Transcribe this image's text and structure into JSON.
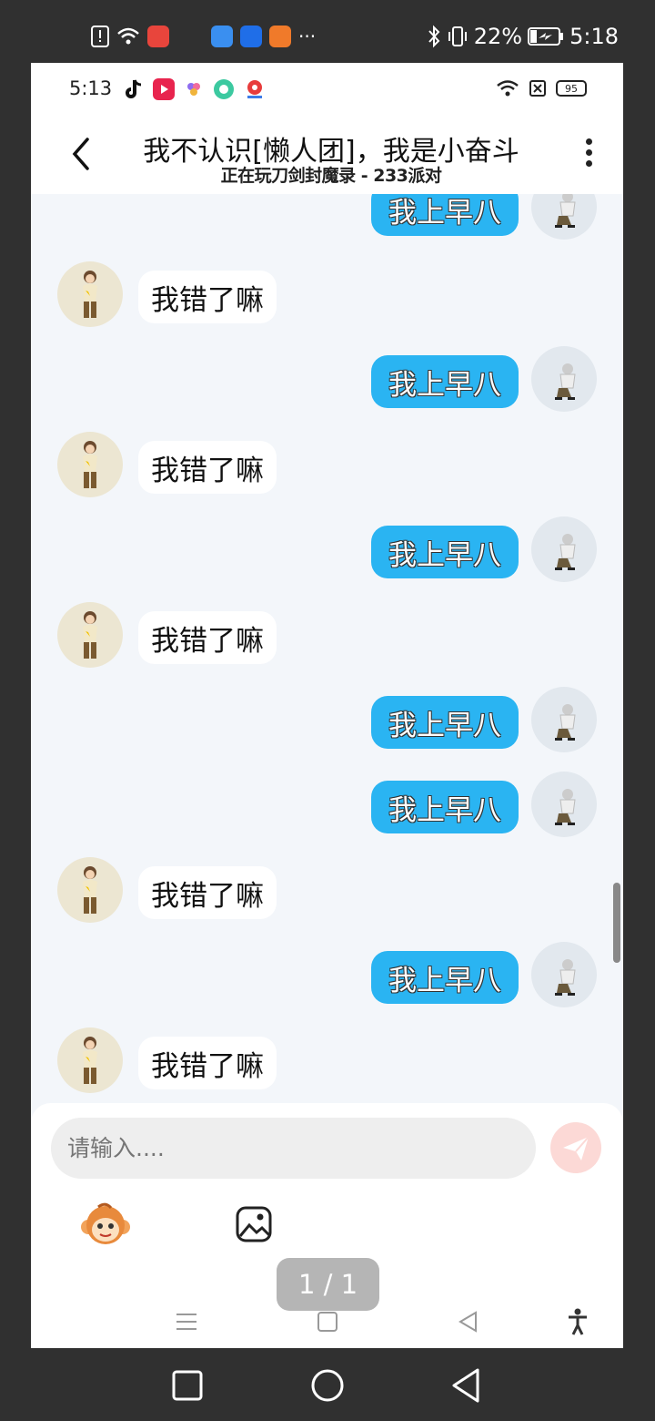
{
  "outer_status": {
    "time": "5:18",
    "battery": "22%"
  },
  "inner_status": {
    "time": "5:13",
    "battery": "95"
  },
  "header": {
    "title": "我不认识[懒人团]，我是小奋斗",
    "subtitle": "正在玩刀剑封魔录 - 233派对"
  },
  "messages": [
    {
      "from": "me",
      "text": "我上早八"
    },
    {
      "from": "her",
      "text": "我错了嘛"
    },
    {
      "from": "me",
      "text": "我上早八"
    },
    {
      "from": "her",
      "text": "我错了嘛"
    },
    {
      "from": "me",
      "text": "我上早八"
    },
    {
      "from": "her",
      "text": "我错了嘛"
    },
    {
      "from": "me",
      "text": "我上早八"
    },
    {
      "from": "me",
      "text": "我上早八"
    },
    {
      "from": "her",
      "text": "我错了嘛"
    },
    {
      "from": "me",
      "text": "我上早八"
    },
    {
      "from": "her",
      "text": "我错了嘛"
    }
  ],
  "composer": {
    "placeholder": "请输入...."
  },
  "pager": "1 / 1",
  "colors": {
    "my_bubble": "#2ab4f2",
    "send_button": "#fcd9d6"
  },
  "icons": [
    "back-icon",
    "more-icon",
    "send-icon",
    "monkey-emoji-icon",
    "gallery-icon"
  ]
}
